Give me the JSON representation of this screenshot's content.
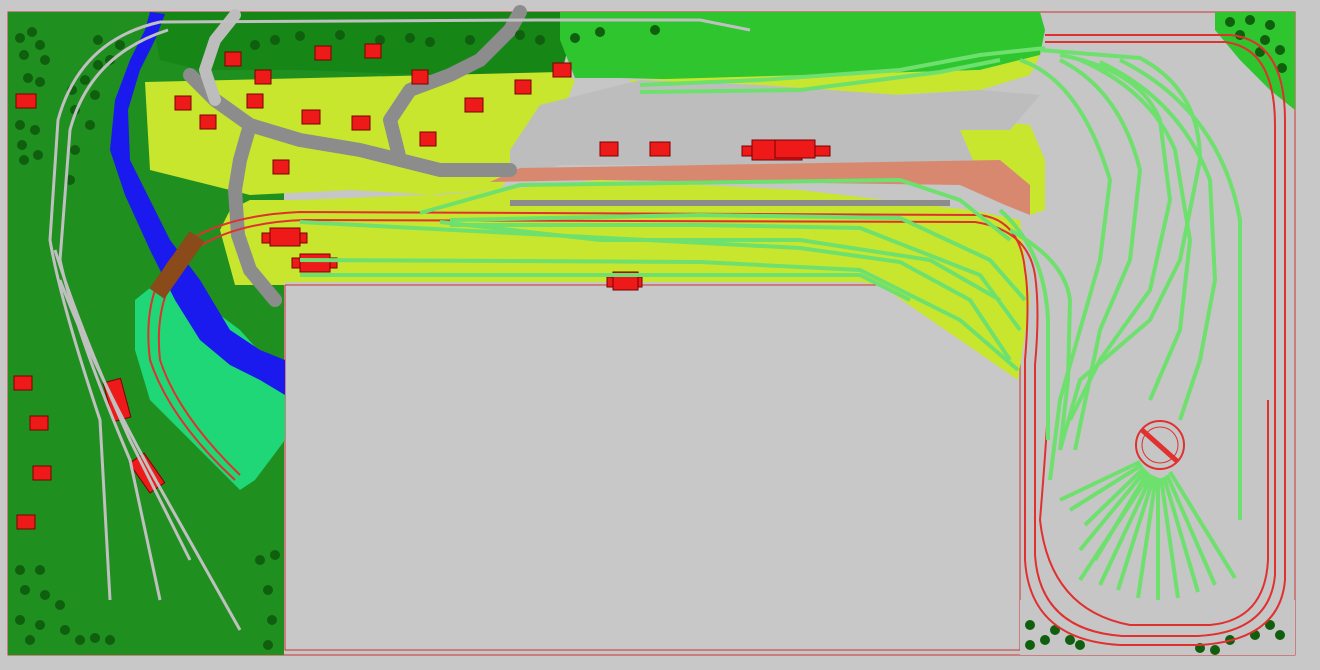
{
  "layout": {
    "title": "",
    "colors": {
      "background": "#c8c8c8",
      "baseboard": "#c6c6c6",
      "grass_dark": "#1f8f1f",
      "grass_mid": "#22a322",
      "grass_light": "#2fc52f",
      "field_yellow": "#c8e62e",
      "meadow": "#1fd777",
      "river": "#1a1aee",
      "road": "#8c8c8c",
      "platform": "#d98870",
      "gravel": "#bdbdbd",
      "track_main": "#e03030",
      "track_yard": "#6ee06e",
      "track_hidden": "#c0c0c0",
      "building": "#ee1a1a",
      "tree": "#0f5f0f",
      "bridge": "#8a4a1a"
    },
    "features": [
      {
        "kind": "baseboard",
        "name": "layout-baseboard"
      },
      {
        "kind": "river",
        "name": "river"
      },
      {
        "kind": "road-network",
        "name": "village-roads"
      },
      {
        "kind": "station",
        "name": "main-station"
      },
      {
        "kind": "turntable",
        "name": "turntable"
      },
      {
        "kind": "engine-shed-fan",
        "name": "engine-shed-roads"
      },
      {
        "kind": "helix-loop",
        "name": "return-loop"
      }
    ]
  }
}
